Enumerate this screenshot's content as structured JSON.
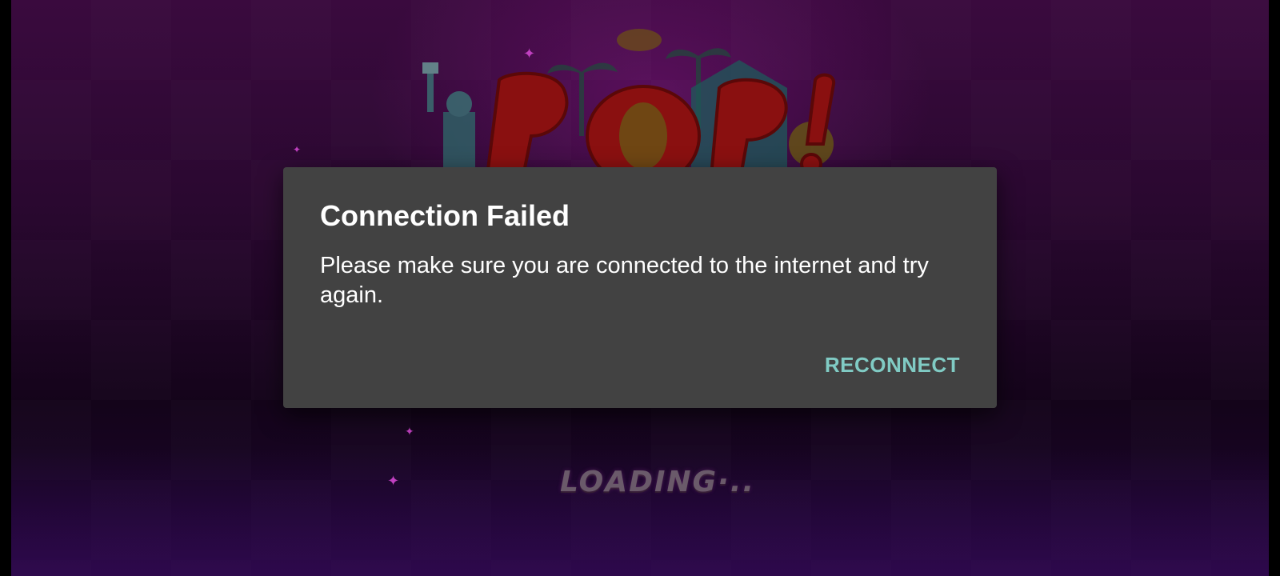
{
  "dialog": {
    "title": "Connection Failed",
    "message": "Please make sure you are connected to the internet and try again.",
    "button_label": "RECONNECT",
    "accent_color": "#80cbc4",
    "background_color": "#424242"
  },
  "game": {
    "logo_text": "POP!",
    "loading_text": "LOADING·.."
  },
  "icons": {
    "sparkle": "✦"
  }
}
